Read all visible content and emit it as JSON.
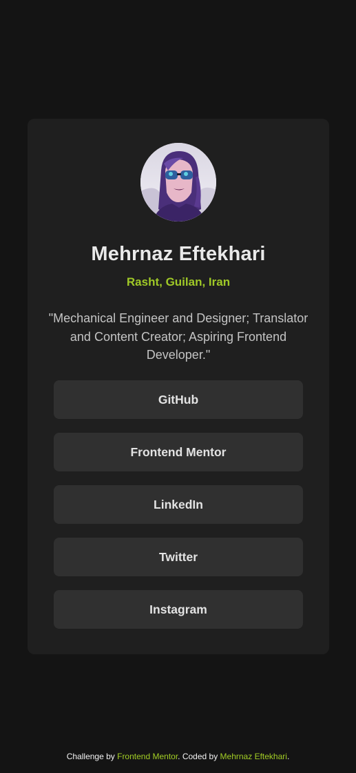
{
  "profile": {
    "avatar_icon": "profile-photo-woman-sunglasses",
    "name": "Mehrnaz Eftekhari",
    "location": "Rasht, Guilan, Iran",
    "bio": "\"Mechanical Engineer and Designer; Translator and Content Creator; Aspiring Frontend Developer.\""
  },
  "links": [
    {
      "label": "GitHub"
    },
    {
      "label": "Frontend Mentor"
    },
    {
      "label": "LinkedIn"
    },
    {
      "label": "Twitter"
    },
    {
      "label": "Instagram"
    }
  ],
  "footer": {
    "prefix": "Challenge by ",
    "challenge_link": "Frontend Mentor",
    "middle": ". Coded by ",
    "author_link": "Mehrnaz Eftekhari",
    "suffix": "."
  },
  "colors": {
    "background": "#141414",
    "card": "#1f1f1f",
    "button": "#333333",
    "accent": "#c4f82a"
  }
}
